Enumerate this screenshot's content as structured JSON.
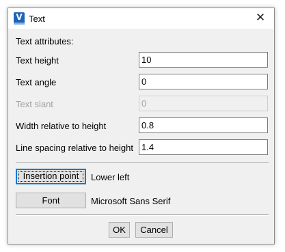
{
  "window": {
    "title": "Text",
    "icon": "app-logo-icon",
    "close_glyph": "✕"
  },
  "section_title": "Text attributes:",
  "fields": {
    "text_height": {
      "label": "Text height",
      "value": "10"
    },
    "text_angle": {
      "label": "Text angle",
      "value": "0"
    },
    "text_slant": {
      "label": "Text slant",
      "value": "0",
      "disabled": true
    },
    "width_ratio": {
      "label": "Width relative to height",
      "value": "0.8"
    },
    "line_spacing": {
      "label": "Line spacing relative to height",
      "value": "1.4"
    }
  },
  "insertion": {
    "button_label": "Insertion point",
    "value": "Lower left"
  },
  "font": {
    "button_label": "Font",
    "value": "Microsoft Sans Serif"
  },
  "footer": {
    "ok_label": "OK",
    "cancel_label": "Cancel"
  },
  "colors": {
    "accent": "#0078d7",
    "disabled_text": "#a0a0a0",
    "icon_blue": "#1f63b8"
  }
}
